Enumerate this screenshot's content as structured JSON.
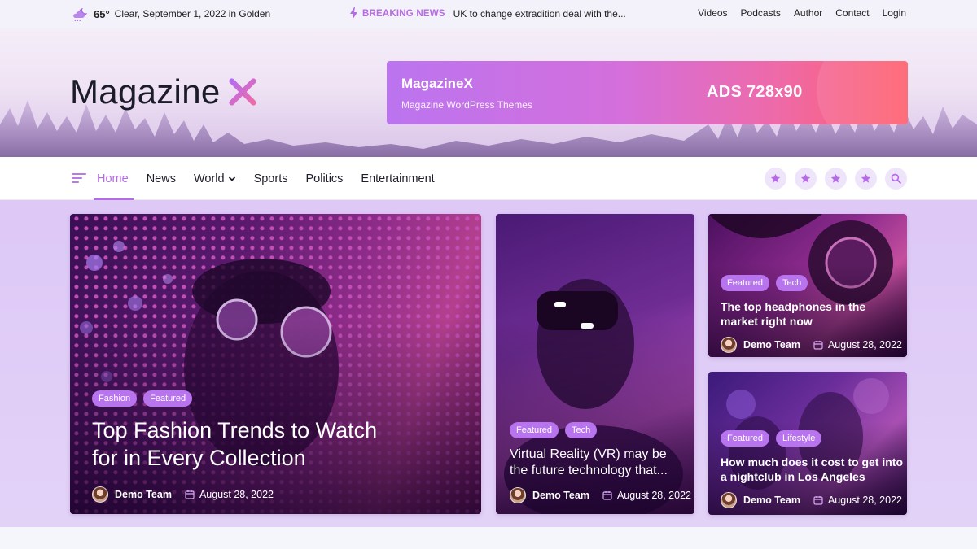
{
  "topbar": {
    "temperature": "65°",
    "weather_text": "Clear, September 1, 2022 in Golden",
    "breaking_label": "BREAKING NEWS",
    "breaking_headline": "UK to change extradition deal with the...",
    "links": [
      "Videos",
      "Podcasts",
      "Author",
      "Contact",
      "Login"
    ]
  },
  "header": {
    "logo_text": "Magazine",
    "ad": {
      "title": "MagazineX",
      "subtitle": "Magazine WordPress Themes",
      "size_label": "ADS 728x90"
    }
  },
  "nav": {
    "items": [
      {
        "label": "Home",
        "active": true
      },
      {
        "label": "News"
      },
      {
        "label": "World",
        "dropdown": true
      },
      {
        "label": "Sports"
      },
      {
        "label": "Politics"
      },
      {
        "label": "Entertainment"
      }
    ],
    "icons": [
      "star-icon",
      "star-icon",
      "star-icon",
      "star-icon",
      "search-icon"
    ]
  },
  "colors": {
    "accent": "#b66ae6",
    "featured_bg": "#ddc8f6"
  },
  "posts": [
    {
      "tags": [
        "Fashion",
        "Featured"
      ],
      "title": "Top Fashion Trends to Watch for in Every Collection",
      "author": "Demo Team",
      "date": "August 28, 2022"
    },
    {
      "tags": [
        "Featured",
        "Tech"
      ],
      "title": "Virtual Reality (VR) may be the future technology that...",
      "author": "Demo Team",
      "date": "August 28, 2022"
    },
    {
      "tags": [
        "Featured",
        "Tech"
      ],
      "title": "The top headphones in the market right now",
      "author": "Demo Team",
      "date": "August 28, 2022"
    },
    {
      "tags": [
        "Featured",
        "Lifestyle"
      ],
      "title": "How much does it cost to get into a nightclub in Los Angeles",
      "author": "Demo Team",
      "date": "August 28, 2022"
    }
  ]
}
